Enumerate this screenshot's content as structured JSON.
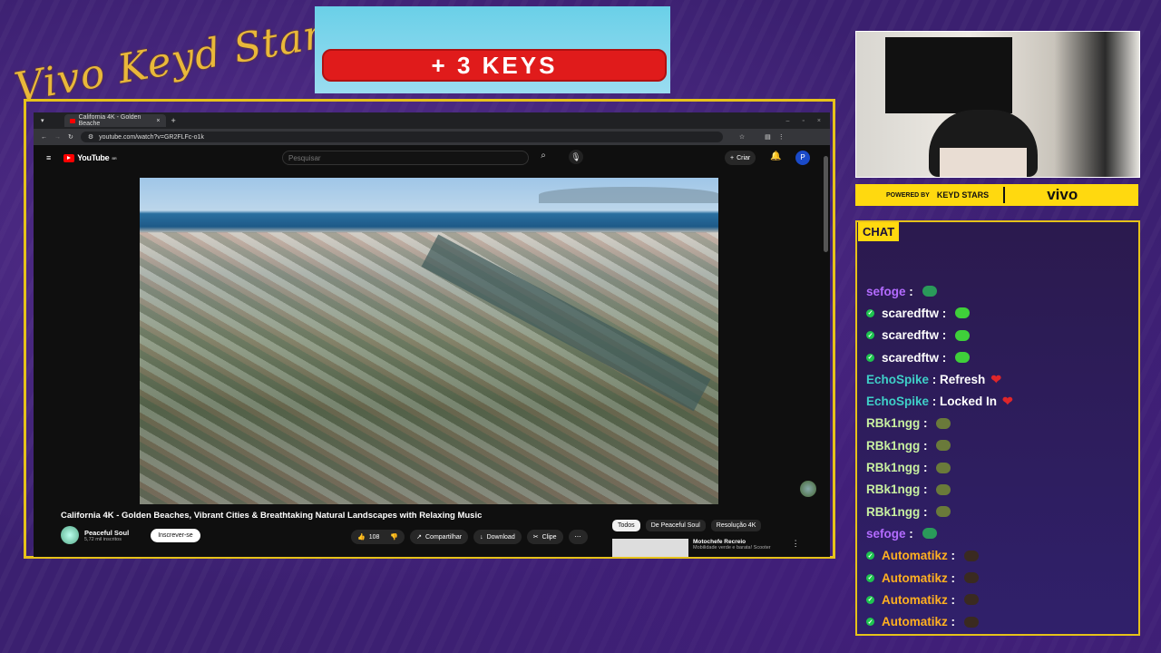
{
  "overlay": {
    "brand_script": "Vivo Keyd Stars",
    "keys_banner": "+ 3 KEYS",
    "powered_by": "POWERED BY",
    "powered_logo": "KEYD STARS",
    "sponsor": "vivo",
    "chat_label": "CHAT"
  },
  "browser": {
    "tab_title": "California 4K - Golden Beache",
    "new_tab": "+",
    "url": "youtube.com/watch?v=GR2FLFc-o1k"
  },
  "youtube": {
    "logo_text": "YouTube",
    "logo_sup": "BR",
    "search_placeholder": "Pesquisar",
    "criar_label": "Criar",
    "account_initial": "P",
    "video_title": "California 4K - Golden Beaches, Vibrant Cities & Breathtaking Natural Landscapes with Relaxing Music",
    "channel_name": "Peaceful Soul",
    "channel_subs": "5,72 mil inscritos",
    "subscribe_label": "Inscrever-se",
    "like_count": "108",
    "share_label": "Compartilhar",
    "download_label": "Download",
    "clip_label": "Clipe",
    "more_label": "⋯",
    "chips": [
      "Todos",
      "De Peaceful Soul",
      "Resolução 4K"
    ],
    "rec_title": "Motochefe Recreio",
    "rec_sub": "Mobilidade verde e barata! Scooter"
  },
  "chat": [
    {
      "user": "sefoge",
      "text": "",
      "color": "#b36bff",
      "badge": false,
      "emote": "#2a9a5a",
      "heart": false
    },
    {
      "user": "scaredftw",
      "text": "",
      "color": "#ffffff",
      "badge": true,
      "emote": "#3fcf3a",
      "heart": false
    },
    {
      "user": "scaredftw",
      "text": "",
      "color": "#ffffff",
      "badge": true,
      "emote": "#3fcf3a",
      "heart": false
    },
    {
      "user": "scaredftw",
      "text": "",
      "color": "#ffffff",
      "badge": true,
      "emote": "#3fcf3a",
      "heart": false
    },
    {
      "user": "EchoSpike",
      "text": "Refresh",
      "color": "#3fd0c8",
      "badge": false,
      "emote": "",
      "heart": true
    },
    {
      "user": "EchoSpike",
      "text": "Locked In",
      "color": "#3fd0c8",
      "badge": false,
      "emote": "",
      "heart": true
    },
    {
      "user": "RBk1ngg",
      "text": "",
      "color": "#c8f0a0",
      "badge": false,
      "emote": "#6a7a3a",
      "heart": false
    },
    {
      "user": "RBk1ngg",
      "text": "",
      "color": "#c8f0a0",
      "badge": false,
      "emote": "#6a7a3a",
      "heart": false
    },
    {
      "user": "RBk1ngg",
      "text": "",
      "color": "#c8f0a0",
      "badge": false,
      "emote": "#6a7a3a",
      "heart": false
    },
    {
      "user": "RBk1ngg",
      "text": "",
      "color": "#c8f0a0",
      "badge": false,
      "emote": "#6a7a3a",
      "heart": false
    },
    {
      "user": "RBk1ngg",
      "text": "",
      "color": "#c8f0a0",
      "badge": false,
      "emote": "#6a7a3a",
      "heart": false
    },
    {
      "user": "sefoge",
      "text": "",
      "color": "#b36bff",
      "badge": false,
      "emote": "#2a9a5a",
      "heart": false
    },
    {
      "user": "Automatikz",
      "text": "",
      "color": "#ffb020",
      "badge": true,
      "emote": "#3a2a20",
      "heart": false
    },
    {
      "user": "Automatikz",
      "text": "",
      "color": "#ffb020",
      "badge": true,
      "emote": "#3a2a20",
      "heart": false
    },
    {
      "user": "Automatikz",
      "text": "",
      "color": "#ffb020",
      "badge": true,
      "emote": "#3a2a20",
      "heart": false
    },
    {
      "user": "Automatikz",
      "text": "",
      "color": "#ffb020",
      "badge": true,
      "emote": "#3a2a20",
      "heart": false
    }
  ]
}
